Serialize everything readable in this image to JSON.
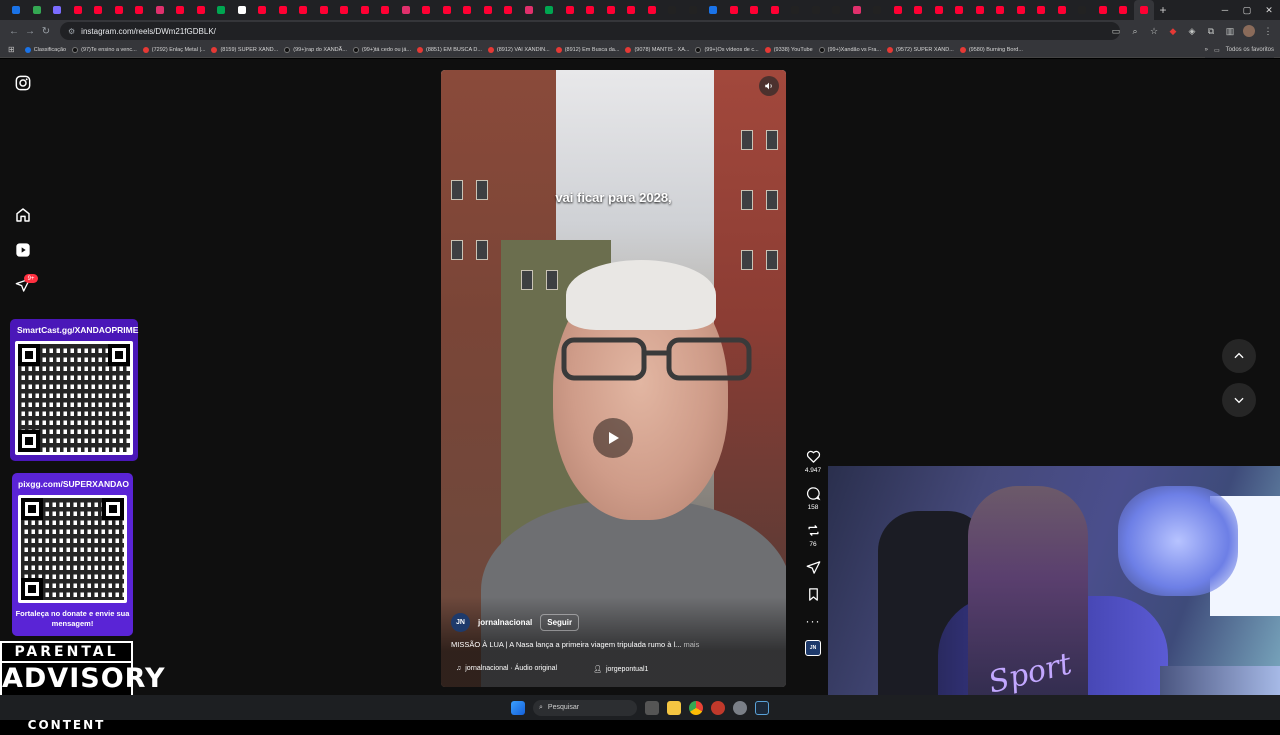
{
  "browser": {
    "url": "instagram.com/reels/DWm21fGDBLK/",
    "tab_favicons": [
      "#1a73e8",
      "#34a853",
      "#7b6cff",
      "#ff0033",
      "#ff0033",
      "#ff0033",
      "#ff0033",
      "#e1306c",
      "#ff0033",
      "#ff0033",
      "#00a651",
      "#ffffff",
      "#ff0033",
      "#ff0033",
      "#ff0033",
      "#ff0033",
      "#ff0033",
      "#ff0033",
      "#ff0033",
      "#e1306c",
      "#ff0033",
      "#ff0033",
      "#ff0033",
      "#ff0033",
      "#ff0033",
      "#e1306c",
      "#00a651",
      "#ff0033",
      "#ff0033",
      "#ff0033",
      "#ff0033",
      "#ff0033",
      "#222222",
      "#222222",
      "#1a73e8",
      "#ff0033",
      "#ff0033",
      "#ff0033",
      "#222222",
      "#222222",
      "#222222",
      "#e1306c",
      "#222222",
      "#ff0033",
      "#ff0033",
      "#ff0033",
      "#ff0033",
      "#ff0033",
      "#ff0033",
      "#ff0033",
      "#ff0033",
      "#ff0033",
      "#222222",
      "#ff0033",
      "#ff0033",
      "#ff0033"
    ]
  },
  "bookmarks": {
    "items": [
      {
        "label": "Classificação",
        "kind": "cl"
      },
      {
        "label": "(97)Te ensino a venc...",
        "kind": "tk"
      },
      {
        "label": "(7292) Enlaç Metal |...",
        "kind": "yt"
      },
      {
        "label": "(8159) SUPER XAND...",
        "kind": "yt"
      },
      {
        "label": "(99+)rap do XANDÃ...",
        "kind": "tk"
      },
      {
        "label": "(99+)tá cedo ou já...",
        "kind": "tk"
      },
      {
        "label": "(8851) EM BUSCA D...",
        "kind": "yt"
      },
      {
        "label": "(8912) VAI XANDIN...",
        "kind": "yt"
      },
      {
        "label": "(8912) Em Busca da...",
        "kind": "yt"
      },
      {
        "label": "(9078) MANTIS - XA...",
        "kind": "yt"
      },
      {
        "label": "(99+)Os vídeos de c...",
        "kind": "tk"
      },
      {
        "label": "(9338) YouTube",
        "kind": "yt"
      },
      {
        "label": "(99+)Xandão vs Fra...",
        "kind": "tk"
      },
      {
        "label": "(9572) SUPER XAND...",
        "kind": "yt"
      },
      {
        "label": "(9580) Burning Bord...",
        "kind": "yt"
      }
    ],
    "all_favorites": "Todos os favoritos"
  },
  "sidebar": {
    "badge": "9+"
  },
  "overlays": {
    "smartcast": "SmartCast.gg/XANDAOPRIME",
    "pixgg": "pixgg.com/SUPERXANDAO",
    "donate_text": "Fortaleça no donate e envie sua mensagem!",
    "advisory_1": "PARENTAL",
    "advisory_2": "ADVISORY",
    "advisory_3": "EXPLICIT CONTENT"
  },
  "reel": {
    "caption_overlay": "vai ficar para 2028,",
    "author": "jornalnacional",
    "author_initials": "JN",
    "follow_label": "Seguir",
    "description": "MISSÃO À LUA | A Nasa lança a primeira viagem tripulada rumo à l...",
    "more_label": "mais",
    "audio": "jornalnacional · Áudio original",
    "tagged_user": "jorgepontual1"
  },
  "actions": {
    "likes": "4.947",
    "comments": "158",
    "reposts": "76"
  },
  "webcam": {
    "shirt_text": "Sport"
  },
  "taskbar": {
    "search_placeholder": "Pesquisar"
  },
  "colors": {
    "instagram_badge": "#ff3040",
    "overlay_purple": "#5a24d6",
    "overlay_purple_dark": "#4a17b8"
  }
}
